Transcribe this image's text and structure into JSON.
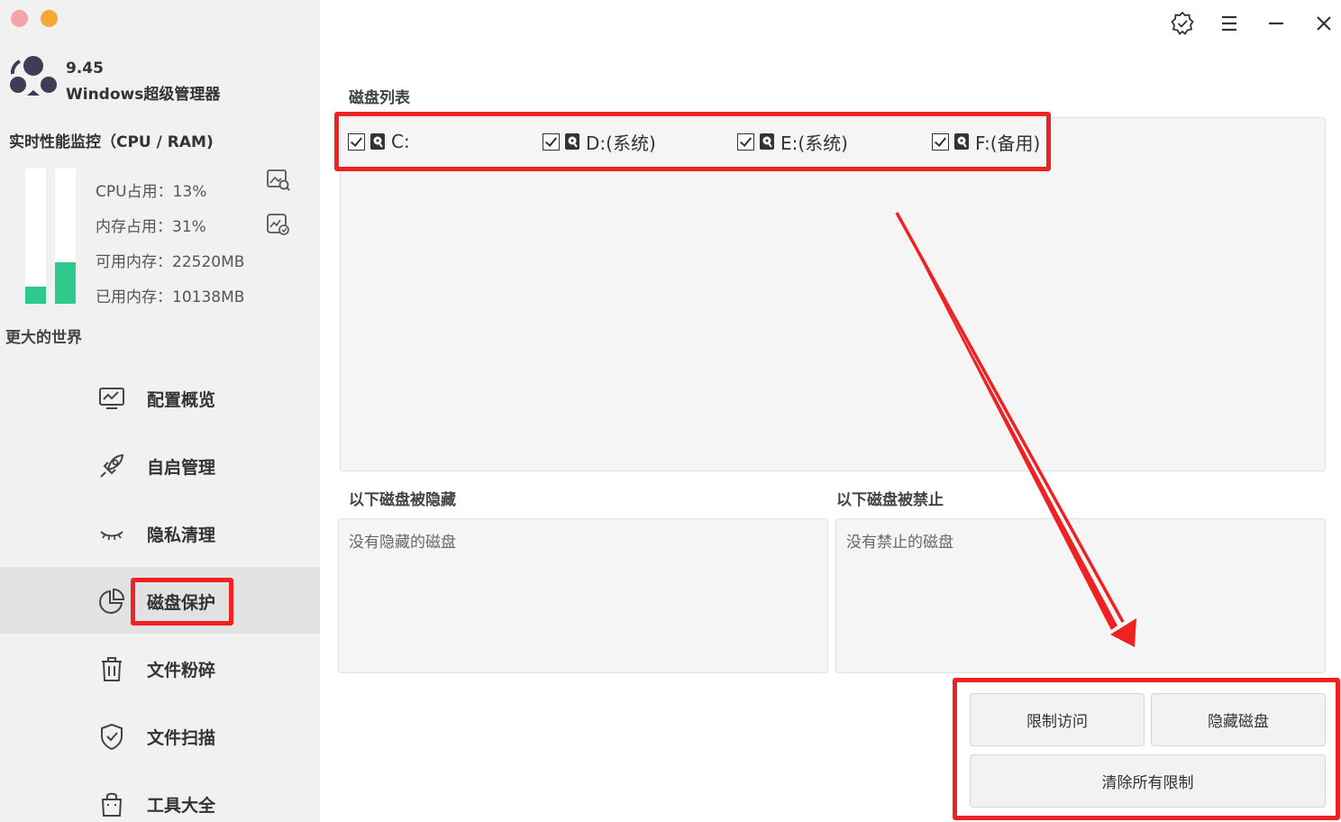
{
  "app": {
    "version": "9.45",
    "name": "Windows超级管理器"
  },
  "monitor": {
    "title": "实时性能监控（CPU / RAM)",
    "cpu_label": "CPU占用：13%",
    "mem_label": "内存占用：31%",
    "avail_label": "可用内存：22520MB",
    "used_label": "已用内存：10138MB",
    "cpu_fill": 0.13,
    "mem_fill": 0.31,
    "fill_color": "#2ec98c"
  },
  "section_world": "更大的世界",
  "nav": [
    {
      "label": "配置概览",
      "icon": "monitor-chart-icon"
    },
    {
      "label": "自启管理",
      "icon": "rocket-icon"
    },
    {
      "label": "隐私清理",
      "icon": "closed-eye-icon"
    },
    {
      "label": "磁盘保护",
      "icon": "pie-chart-icon",
      "active": true
    },
    {
      "label": "文件粉碎",
      "icon": "trash-icon"
    },
    {
      "label": "文件扫描",
      "icon": "shield-check-icon"
    },
    {
      "label": "工具大全",
      "icon": "bag-icon"
    }
  ],
  "disk_list": {
    "title": "磁盘列表",
    "drives": [
      {
        "label": "C:",
        "checked": true
      },
      {
        "label": "D:(系统)",
        "checked": true
      },
      {
        "label": "E:(系统)",
        "checked": true
      },
      {
        "label": "F:(备用)",
        "checked": true
      }
    ]
  },
  "hidden": {
    "title": "以下磁盘被隐藏",
    "empty_text": "没有隐藏的磁盘"
  },
  "forbidden": {
    "title": "以下磁盘被禁止",
    "empty_text": "没有禁止的磁盘"
  },
  "buttons": {
    "restrict": "限制访问",
    "hide": "隐藏磁盘",
    "clear": "清除所有限制"
  },
  "colors": {
    "highlight": "#ee2222",
    "accent_green": "#2ec98c"
  }
}
